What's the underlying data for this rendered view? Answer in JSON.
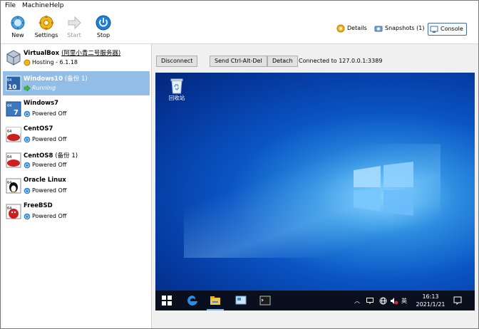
{
  "menu": {
    "file": "File",
    "machine": "Machine",
    "help": "Help"
  },
  "toolbar": {
    "new_label": "New",
    "settings_label": "Settings",
    "start_label": "Start",
    "stop_label": "Stop",
    "details_label": "Details",
    "snapshots_label": "Snapshots (1)",
    "console_label": "Console"
  },
  "host": {
    "name": "VirtualBox",
    "name_sub": "(阿里小青二号服务器)",
    "status": "Hosting - 6.1.18"
  },
  "vms": [
    {
      "name": "Windows10",
      "sub": "(备份 1)",
      "status": "Running"
    },
    {
      "name": "Windows7",
      "sub": "",
      "status": "Powered Off"
    },
    {
      "name": "CentOS7",
      "sub": "",
      "status": "Powered Off"
    },
    {
      "name": "CentOS8",
      "sub": "(备份 1)",
      "status": "Powered Off"
    },
    {
      "name": "Oracle Linux",
      "sub": "",
      "status": "Powered Off"
    },
    {
      "name": "FreeBSD",
      "sub": "",
      "status": "Powered Off"
    }
  ],
  "console": {
    "disconnect_label": "Disconnect",
    "ctrl_alt_del_label": "Send Ctrl-Alt-Del",
    "detach_label": "Detach",
    "connection_text": "Connected to 127.0.0.1:3389"
  },
  "desktop": {
    "recycle_bin_label": "回收站",
    "ime_label": "英",
    "time": "16:13",
    "date": "2021/1/21"
  },
  "colors": {
    "selection": "#92bde6",
    "desktop_blue": "#0a55c4",
    "taskbar": "#0a0f1e"
  }
}
